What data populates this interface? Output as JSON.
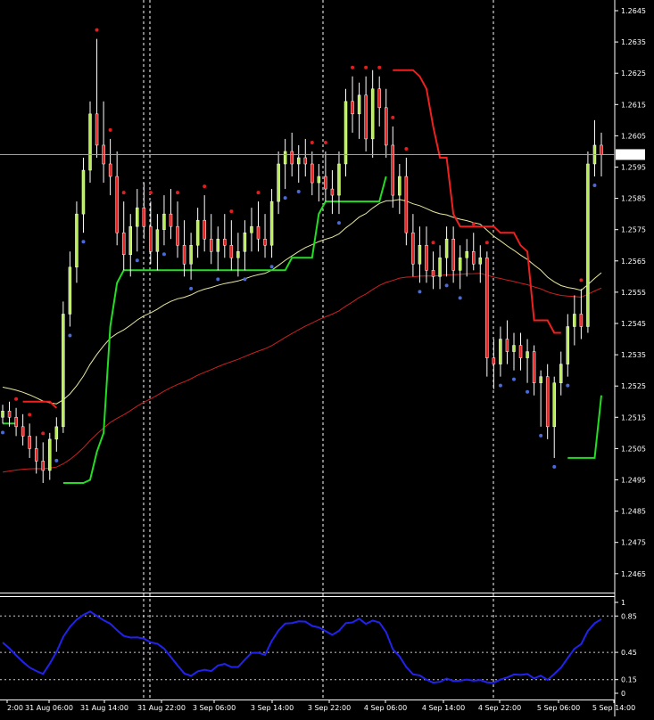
{
  "chart_data": [
    {
      "type": "candlestick",
      "symbol": "",
      "y_ticks": [
        "1.2645",
        "1.2635",
        "1.2625",
        "1.2615",
        "1.2605",
        "1.2595",
        "1.2585",
        "1.2575",
        "1.2565",
        "1.2555",
        "1.2545",
        "1.2535",
        "1.2525",
        "1.2515",
        "1.2505",
        "1.2495",
        "1.2485",
        "1.2475",
        "1.2465"
      ],
      "ylim": [
        1.246,
        1.265
      ],
      "x_labels": [
        "2:00",
        "31 Aug 06:00",
        "31 Aug 14:00",
        "31 Aug 22:00",
        "3 Sep 06:00",
        "3 Sep 14:00",
        "3 Sep 22:00",
        "4 Sep 06:00",
        "4 Sep 14:00",
        "4 Sep 22:00",
        "5 Sep 06:00",
        "5 Sep 14:00"
      ],
      "current_price": "1.2599",
      "candles": [
        [
          1.2515,
          1.2519,
          1.2513,
          1.2517
        ],
        [
          1.2517,
          1.252,
          1.2512,
          1.2515
        ],
        [
          1.2515,
          1.2518,
          1.2509,
          1.2512
        ],
        [
          1.2512,
          1.2516,
          1.2506,
          1.2509
        ],
        [
          1.2509,
          1.2513,
          1.2502,
          1.2505
        ],
        [
          1.2505,
          1.2509,
          1.2497,
          1.2501
        ],
        [
          1.2501,
          1.2507,
          1.2494,
          1.2498
        ],
        [
          1.2498,
          1.251,
          1.2495,
          1.2508
        ],
        [
          1.2508,
          1.2515,
          1.2504,
          1.2512
        ],
        [
          1.2512,
          1.2552,
          1.251,
          1.2548
        ],
        [
          1.2548,
          1.2568,
          1.2544,
          1.2563
        ],
        [
          1.2563,
          1.2584,
          1.2558,
          1.258
        ],
        [
          1.258,
          1.2598,
          1.2574,
          1.2594
        ],
        [
          1.2594,
          1.2616,
          1.259,
          1.2612
        ],
        [
          1.2612,
          1.2636,
          1.2598,
          1.2602
        ],
        [
          1.2602,
          1.2616,
          1.259,
          1.2596
        ],
        [
          1.2596,
          1.2604,
          1.2586,
          1.2592
        ],
        [
          1.2592,
          1.26,
          1.257,
          1.2574
        ],
        [
          1.2574,
          1.2584,
          1.2562,
          1.2567
        ],
        [
          1.2567,
          1.258,
          1.256,
          1.2576
        ],
        [
          1.2576,
          1.2588,
          1.2568,
          1.2582
        ],
        [
          1.2582,
          1.259,
          1.2572,
          1.2576
        ],
        [
          1.2576,
          1.2584,
          1.2564,
          1.2568
        ],
        [
          1.2568,
          1.258,
          1.2562,
          1.2575
        ],
        [
          1.2575,
          1.2586,
          1.257,
          1.258
        ],
        [
          1.258,
          1.2588,
          1.2572,
          1.2576
        ],
        [
          1.2576,
          1.2584,
          1.2566,
          1.257
        ],
        [
          1.257,
          1.2578,
          1.256,
          1.2564
        ],
        [
          1.2564,
          1.2574,
          1.2559,
          1.257
        ],
        [
          1.257,
          1.2582,
          1.2566,
          1.2578
        ],
        [
          1.2578,
          1.2586,
          1.2568,
          1.2572
        ],
        [
          1.2572,
          1.258,
          1.2564,
          1.2568
        ],
        [
          1.2568,
          1.2576,
          1.2562,
          1.2572
        ],
        [
          1.2572,
          1.258,
          1.2566,
          1.257
        ],
        [
          1.257,
          1.2578,
          1.2562,
          1.2566
        ],
        [
          1.2566,
          1.2574,
          1.256,
          1.2568
        ],
        [
          1.2568,
          1.2578,
          1.2562,
          1.2574
        ],
        [
          1.2574,
          1.2582,
          1.2568,
          1.2576
        ],
        [
          1.2576,
          1.2584,
          1.2568,
          1.2572
        ],
        [
          1.2572,
          1.258,
          1.2566,
          1.257
        ],
        [
          1.257,
          1.2588,
          1.2566,
          1.2584
        ],
        [
          1.2584,
          1.26,
          1.258,
          1.2596
        ],
        [
          1.2596,
          1.2604,
          1.2588,
          1.26
        ],
        [
          1.26,
          1.2606,
          1.2592,
          1.2596
        ],
        [
          1.2596,
          1.2602,
          1.259,
          1.2598
        ],
        [
          1.2598,
          1.2604,
          1.2592,
          1.2596
        ],
        [
          1.2596,
          1.26,
          1.2586,
          1.259
        ],
        [
          1.259,
          1.2596,
          1.2584,
          1.2592
        ],
        [
          1.2592,
          1.26,
          1.2584,
          1.2588
        ],
        [
          1.2588,
          1.2594,
          1.258,
          1.2586
        ],
        [
          1.2586,
          1.26,
          1.258,
          1.2596
        ],
        [
          1.2596,
          1.262,
          1.2592,
          1.2616
        ],
        [
          1.2616,
          1.2624,
          1.2606,
          1.2612
        ],
        [
          1.2612,
          1.2622,
          1.2604,
          1.2618
        ],
        [
          1.2618,
          1.2624,
          1.26,
          1.2604
        ],
        [
          1.2604,
          1.2626,
          1.2598,
          1.262
        ],
        [
          1.262,
          1.2624,
          1.2608,
          1.2614
        ],
        [
          1.2614,
          1.262,
          1.2598,
          1.2602
        ],
        [
          1.2602,
          1.2608,
          1.2582,
          1.2586
        ],
        [
          1.2586,
          1.2596,
          1.258,
          1.2592
        ],
        [
          1.2592,
          1.2598,
          1.257,
          1.2574
        ],
        [
          1.2574,
          1.258,
          1.256,
          1.2564
        ],
        [
          1.2564,
          1.2576,
          1.2558,
          1.257
        ],
        [
          1.257,
          1.2576,
          1.2558,
          1.2562
        ],
        [
          1.2562,
          1.2568,
          1.2556,
          1.256
        ],
        [
          1.256,
          1.257,
          1.2556,
          1.2566
        ],
        [
          1.2566,
          1.2576,
          1.256,
          1.2572
        ],
        [
          1.2572,
          1.2576,
          1.2558,
          1.2562
        ],
        [
          1.2562,
          1.257,
          1.2556,
          1.2566
        ],
        [
          1.2566,
          1.2572,
          1.256,
          1.2568
        ],
        [
          1.2568,
          1.2574,
          1.2562,
          1.2564
        ],
        [
          1.2564,
          1.257,
          1.2558,
          1.2566
        ],
        [
          1.2566,
          1.2568,
          1.2528,
          1.2534
        ],
        [
          1.2534,
          1.254,
          1.2524,
          1.2532
        ],
        [
          1.2532,
          1.2544,
          1.2528,
          1.254
        ],
        [
          1.254,
          1.2546,
          1.2532,
          1.2536
        ],
        [
          1.2536,
          1.2542,
          1.253,
          1.2538
        ],
        [
          1.2538,
          1.2542,
          1.253,
          1.2534
        ],
        [
          1.2534,
          1.254,
          1.2526,
          1.2536
        ],
        [
          1.2536,
          1.2538,
          1.2522,
          1.2526
        ],
        [
          1.2526,
          1.253,
          1.2512,
          1.2528
        ],
        [
          1.2528,
          1.2532,
          1.2508,
          1.2512
        ],
        [
          1.2512,
          1.2528,
          1.2502,
          1.2526
        ],
        [
          1.2526,
          1.2536,
          1.2522,
          1.2532
        ],
        [
          1.2532,
          1.2548,
          1.2528,
          1.2544
        ],
        [
          1.2544,
          1.2554,
          1.2538,
          1.2548
        ],
        [
          1.2548,
          1.2556,
          1.254,
          1.2544
        ],
        [
          1.2544,
          1.26,
          1.2542,
          1.2596
        ],
        [
          1.2596,
          1.261,
          1.2592,
          1.2602
        ],
        [
          1.2602,
          1.2606,
          1.2592,
          1.2599
        ]
      ],
      "oscillator_ticks": [
        "1",
        "0.85",
        "0.45",
        "0.15",
        "0"
      ]
    }
  ]
}
